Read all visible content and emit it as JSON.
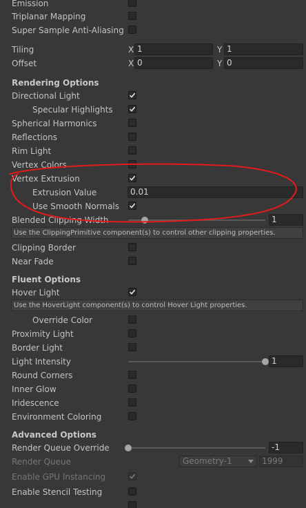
{
  "shader_rows": {
    "emission": "Emission",
    "triplanar": "Triplanar Mapping",
    "ssaa": "Super Sample Anti-Aliasing"
  },
  "tiling": {
    "label": "Tiling",
    "x_axis": "X",
    "y_axis": "Y",
    "x": "1",
    "y": "1"
  },
  "offset": {
    "label": "Offset",
    "x_axis": "X",
    "y_axis": "Y",
    "x": "0",
    "y": "0"
  },
  "rendering": {
    "header": "Rendering Options",
    "directional_light": "Directional Light",
    "specular_highlights": "Specular Highlights",
    "spherical_harmonics": "Spherical Harmonics",
    "reflections": "Reflections",
    "rim_light": "Rim Light",
    "vertex_colors": "Vertex Colors",
    "vertex_extrusion": "Vertex Extrusion",
    "extrusion_value_label": "Extrusion Value",
    "extrusion_value": "0.01",
    "use_smooth_normals": "Use Smooth Normals",
    "blended_clipping_width": "Blended Clipping Width",
    "blended_clipping_value": "1",
    "blended_clipping_slider": 0.12,
    "clipping_help": "Use the ClippingPrimitive component(s) to control other clipping properties.",
    "clipping_border": "Clipping Border",
    "near_fade": "Near Fade"
  },
  "fluent": {
    "header": "Fluent Options",
    "hover_light": "Hover Light",
    "hover_help": "Use the HoverLight component(s) to control Hover Light properties.",
    "override_color": "Override Color",
    "proximity_light": "Proximity Light",
    "border_light": "Border Light",
    "light_intensity": "Light Intensity",
    "light_intensity_value": "1",
    "light_intensity_slider": 1.0,
    "round_corners": "Round Corners",
    "inner_glow": "Inner Glow",
    "iridescence": "Iridescence",
    "environment_coloring": "Environment Coloring"
  },
  "advanced": {
    "header": "Advanced Options",
    "render_queue_override": "Render Queue Override",
    "render_queue_override_value": "-1",
    "render_queue_override_slider": 0.0,
    "render_queue": "Render Queue",
    "render_queue_option": "Geometry-1",
    "render_queue_value": "1999",
    "gpu_instancing": "Enable GPU Instancing",
    "stencil_testing": "Enable Stencil Testing"
  },
  "colors": {
    "background": "#383838",
    "annotation": "#e31b1b"
  }
}
